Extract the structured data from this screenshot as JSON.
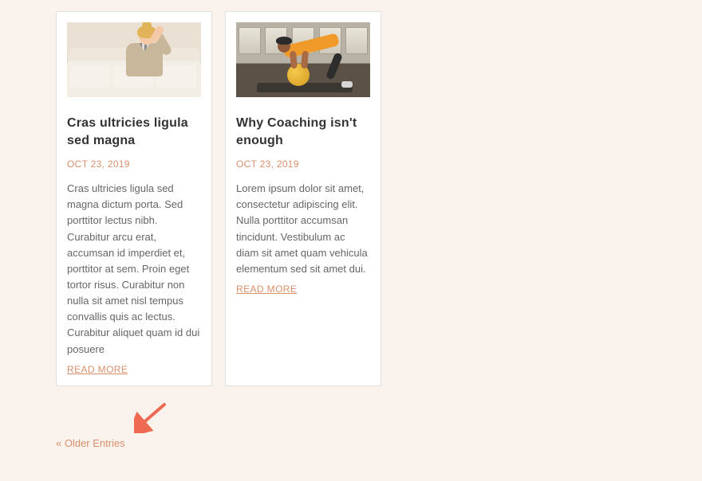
{
  "posts": [
    {
      "title": "Cras ultricies ligula sed magna",
      "date": "OCT 23, 2019",
      "excerpt": "Cras ultricies ligula sed magna dictum porta. Sed porttitor lectus nibh. Curabitur arcu erat, accumsan id imperdiet et, porttitor at sem. Proin eget tortor risus. Curabitur non nulla sit amet nisl tempus convallis quis ac lectus. Curabitur aliquet quam id dui posuere",
      "readmore": "READ MORE"
    },
    {
      "title": "Why Coaching isn't enough",
      "date": "OCT 23, 2019",
      "excerpt": "Lorem ipsum dolor sit amet, consectetur adipiscing elit. Nulla porttitor accumsan tincidunt. Vestibulum ac diam sit amet quam vehicula elementum sed sit amet dui.",
      "readmore": "READ MORE"
    }
  ],
  "pagination": {
    "older": "« Older Entries"
  },
  "annotation": {
    "arrow_color": "#ef6a52"
  }
}
